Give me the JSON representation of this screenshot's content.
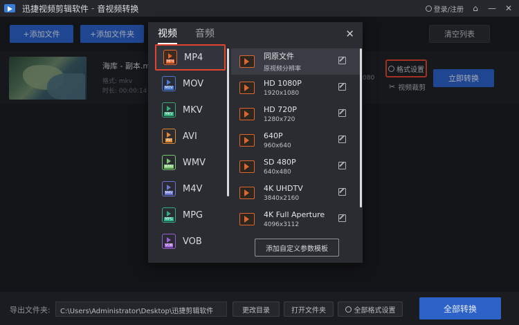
{
  "window": {
    "app_name": "迅捷视频剪辑软件",
    "separator": "-",
    "page_name": "音视频转换",
    "user_link": "登录/注册",
    "home_glyph": "⌂",
    "min_glyph": "—",
    "close_glyph": "✕"
  },
  "toolbar": {
    "add_file": "+添加文件",
    "add_folder": "+添加文件夹",
    "clear_list": "清空列表"
  },
  "file": {
    "name": "海库 - 副本.m",
    "format_line": "格式: mkv",
    "duration_line": "时长: 00:00:14",
    "resolution_tail": "080",
    "format_settings": "格式设置",
    "video_cut": "视频裁剪",
    "convert_now": "立即转换"
  },
  "dialog": {
    "tabs": [
      "视频",
      "音频"
    ],
    "active_tab": 0,
    "close_glyph": "✕",
    "formats": [
      {
        "label": "MP4",
        "tag": "MP4",
        "color": "#e0652f"
      },
      {
        "label": "MOV",
        "tag": "MOV",
        "color": "#4a78d6"
      },
      {
        "label": "MKV",
        "tag": "MKV",
        "color": "#2fae76"
      },
      {
        "label": "AVI",
        "tag": "AVI",
        "color": "#e0892f"
      },
      {
        "label": "WMV",
        "tag": "WMV",
        "color": "#7ac86e"
      },
      {
        "label": "M4V",
        "tag": "M4V",
        "color": "#6a76d8"
      },
      {
        "label": "MPG",
        "tag": "MPG",
        "color": "#2fae8e"
      },
      {
        "label": "VOB",
        "tag": "VOB",
        "color": "#9a5fd8"
      }
    ],
    "selected_format": 0,
    "resolutions": [
      {
        "name": "同原文件",
        "dim": "原视频分辨率"
      },
      {
        "name": "HD 1080P",
        "dim": "1920x1080"
      },
      {
        "name": "HD 720P",
        "dim": "1280x720"
      },
      {
        "name": "640P",
        "dim": "960x640"
      },
      {
        "name": "SD 480P",
        "dim": "640x480"
      },
      {
        "name": "4K UHDTV",
        "dim": "3840x2160"
      },
      {
        "name": "4K Full Aperture",
        "dim": "4096x3112"
      }
    ],
    "highlighted_resolution": 0,
    "custom_button": "添加自定义参数模板"
  },
  "bottom": {
    "output_label": "导出文件夹:",
    "output_path": "C:\\Users\\Administrator\\Desktop\\迅捷剪辑软件",
    "change_dir": "更改目录",
    "open_folder": "打开文件夹",
    "all_format_settings": "全部格式设置",
    "convert_all": "全部转换"
  },
  "colors": {
    "accent": "#2d62c9",
    "highlight_border": "#e2442f",
    "video_icon": "#e0652f"
  }
}
